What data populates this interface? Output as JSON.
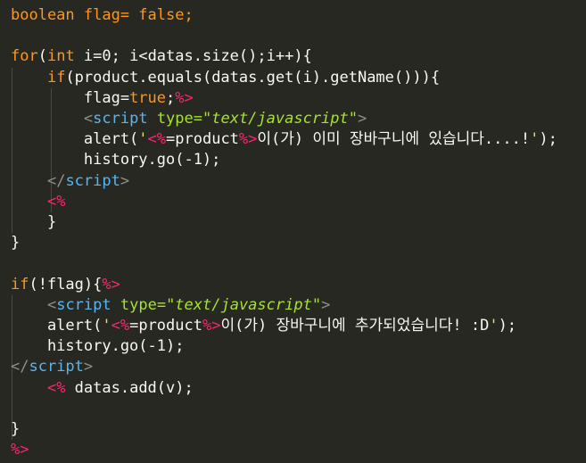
{
  "editor": {
    "background": "#272822",
    "lines": [
      [
        {
          "t": "boolean flag= false;",
          "c": "orange"
        }
      ],
      [],
      [
        {
          "t": "for",
          "c": "orange"
        },
        {
          "t": "(",
          "c": "white"
        },
        {
          "t": "int",
          "c": "orange"
        },
        {
          "t": " i=0; i<datas.size();i++){",
          "c": "white"
        }
      ],
      [
        {
          "t": "    "
        },
        {
          "t": "if",
          "c": "orange"
        },
        {
          "t": "(product.equals(datas.get(i).getName())){",
          "c": "white"
        }
      ],
      [
        {
          "t": "        flag=",
          "c": "white"
        },
        {
          "t": "true",
          "c": "orange"
        },
        {
          "t": ";",
          "c": "white"
        },
        {
          "t": "%>",
          "c": "delim"
        }
      ],
      [
        {
          "t": "        "
        },
        {
          "t": "<",
          "c": "gray"
        },
        {
          "t": "script",
          "c": "tag"
        },
        {
          "t": " "
        },
        {
          "t": "type=",
          "c": "attr"
        },
        {
          "t": "\"text/javascript\"",
          "c": "str"
        },
        {
          "t": ">",
          "c": "gray"
        }
      ],
      [
        {
          "t": "        alert(",
          "c": "white"
        },
        {
          "t": "'",
          "c": "gold"
        },
        {
          "t": "<%",
          "c": "delim"
        },
        {
          "t": "=product",
          "c": "white"
        },
        {
          "t": "%>",
          "c": "delim"
        },
        {
          "t": "이(가) 이미 장바구니에 있습니다....!",
          "c": "white"
        },
        {
          "t": "'",
          "c": "gold"
        },
        {
          "t": ");",
          "c": "white"
        }
      ],
      [
        {
          "t": "        history.go(-1);",
          "c": "white"
        }
      ],
      [
        {
          "t": "    "
        },
        {
          "t": "</",
          "c": "gray"
        },
        {
          "t": "script",
          "c": "tag"
        },
        {
          "t": ">",
          "c": "gray"
        }
      ],
      [
        {
          "t": "    "
        },
        {
          "t": "<%",
          "c": "delim"
        }
      ],
      [
        {
          "t": "    }",
          "c": "white"
        }
      ],
      [
        {
          "t": "}",
          "c": "white"
        }
      ],
      [],
      [
        {
          "t": "if",
          "c": "orange"
        },
        {
          "t": "(!flag){",
          "c": "white"
        },
        {
          "t": "%>",
          "c": "delim"
        }
      ],
      [
        {
          "t": "    "
        },
        {
          "t": "<",
          "c": "gray"
        },
        {
          "t": "script",
          "c": "tag"
        },
        {
          "t": " "
        },
        {
          "t": "type=",
          "c": "attr"
        },
        {
          "t": "\"text/javascript\"",
          "c": "str"
        },
        {
          "t": ">",
          "c": "gray"
        }
      ],
      [
        {
          "t": "    alert(",
          "c": "white"
        },
        {
          "t": "'",
          "c": "gold"
        },
        {
          "t": "<%",
          "c": "delim"
        },
        {
          "t": "=product",
          "c": "white"
        },
        {
          "t": "%>",
          "c": "delim"
        },
        {
          "t": "이(가) 장바구니에 추가되었습니다! :D",
          "c": "white"
        },
        {
          "t": "'",
          "c": "gold"
        },
        {
          "t": ");",
          "c": "white"
        }
      ],
      [
        {
          "t": "    history.go(-1);",
          "c": "white"
        }
      ],
      [
        {
          "t": "</",
          "c": "gray"
        },
        {
          "t": "script",
          "c": "tag"
        },
        {
          "t": ">",
          "c": "gray"
        }
      ],
      [
        {
          "t": "    "
        },
        {
          "t": "<%",
          "c": "delim"
        },
        {
          "t": " datas.add(v);",
          "c": "white"
        }
      ],
      [],
      [
        {
          "t": "}",
          "c": "white"
        }
      ],
      [
        {
          "t": "%>",
          "c": "delim"
        }
      ]
    ]
  }
}
